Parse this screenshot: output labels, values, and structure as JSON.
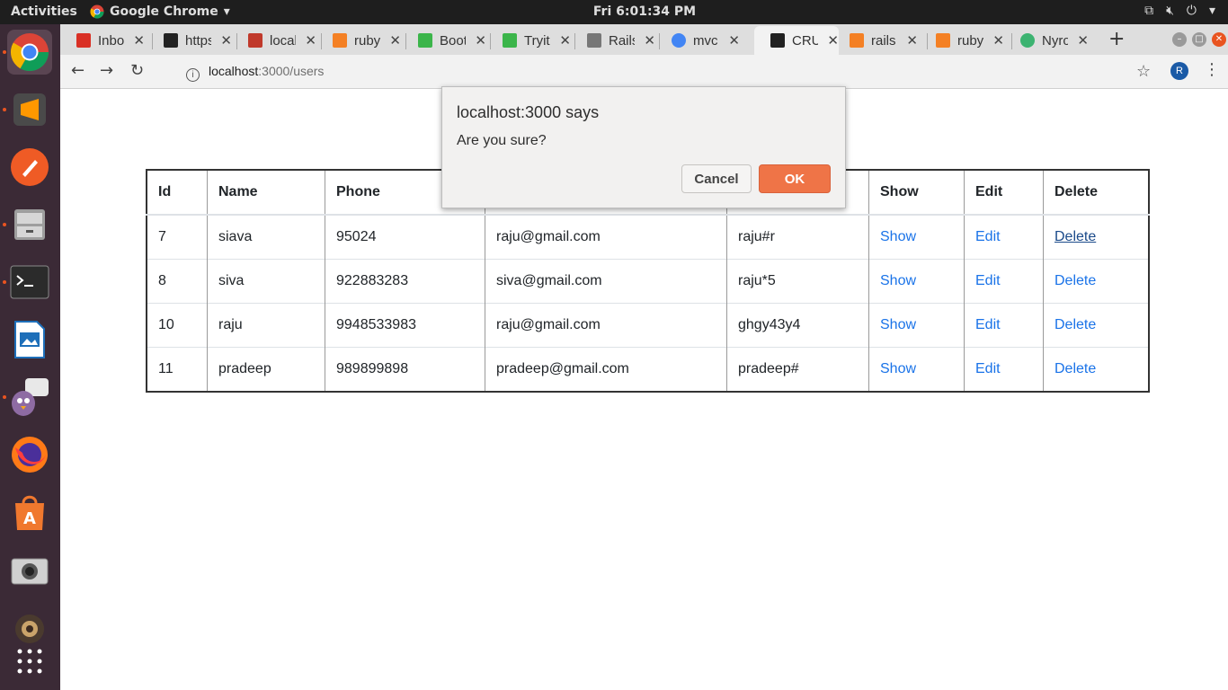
{
  "topbar": {
    "activities": "Activities",
    "app_name": "Google Chrome",
    "clock": "Fri  6:01:34 PM"
  },
  "tabs": [
    {
      "title": "Inbox",
      "color": "#d93025"
    },
    {
      "title": "https",
      "color": "#222222"
    },
    {
      "title": "localhost",
      "color": "#c0392b"
    },
    {
      "title": "ruby",
      "color": "#f48024"
    },
    {
      "title": "Boot",
      "color": "#3bb54a"
    },
    {
      "title": "Tryit",
      "color": "#3bb54a"
    },
    {
      "title": "Rails",
      "color": "#555555"
    },
    {
      "title": "mvc",
      "color": "#4285f4"
    },
    {
      "title": "CRUD",
      "color": "#222222",
      "active": true
    },
    {
      "title": "rails",
      "color": "#f48024"
    },
    {
      "title": "ruby",
      "color": "#f48024"
    },
    {
      "title": "Nyro",
      "color": "#3cb371"
    }
  ],
  "toolbar": {
    "url_host": "localhost",
    "url_path": ":3000/users",
    "avatar_letter": "R"
  },
  "table": {
    "headers": [
      "Id",
      "Name",
      "Phone",
      "",
      "",
      "Show",
      "Edit",
      "Delete"
    ],
    "rows": [
      {
        "id": "7",
        "name": "siava",
        "phone": "95024",
        "email": "raju@gmail.com",
        "password": "raju#r",
        "show": "Show",
        "edit": "Edit",
        "delete": "Delete"
      },
      {
        "id": "8",
        "name": "siva",
        "phone": "922883283",
        "email": "siva@gmail.com",
        "password": "raju*5",
        "show": "Show",
        "edit": "Edit",
        "delete": "Delete"
      },
      {
        "id": "10",
        "name": "raju",
        "phone": "9948533983",
        "email": "raju@gmail.com",
        "password": "ghgy43y4",
        "show": "Show",
        "edit": "Edit",
        "delete": "Delete"
      },
      {
        "id": "11",
        "name": "pradeep",
        "phone": "989899898",
        "email": "pradeep@gmail.com",
        "password": "pradeep#",
        "show": "Show",
        "edit": "Edit",
        "delete": "Delete"
      }
    ]
  },
  "dialog": {
    "title": "localhost:3000 says",
    "message": "Are you sure?",
    "cancel_label": "Cancel",
    "ok_label": "OK"
  }
}
